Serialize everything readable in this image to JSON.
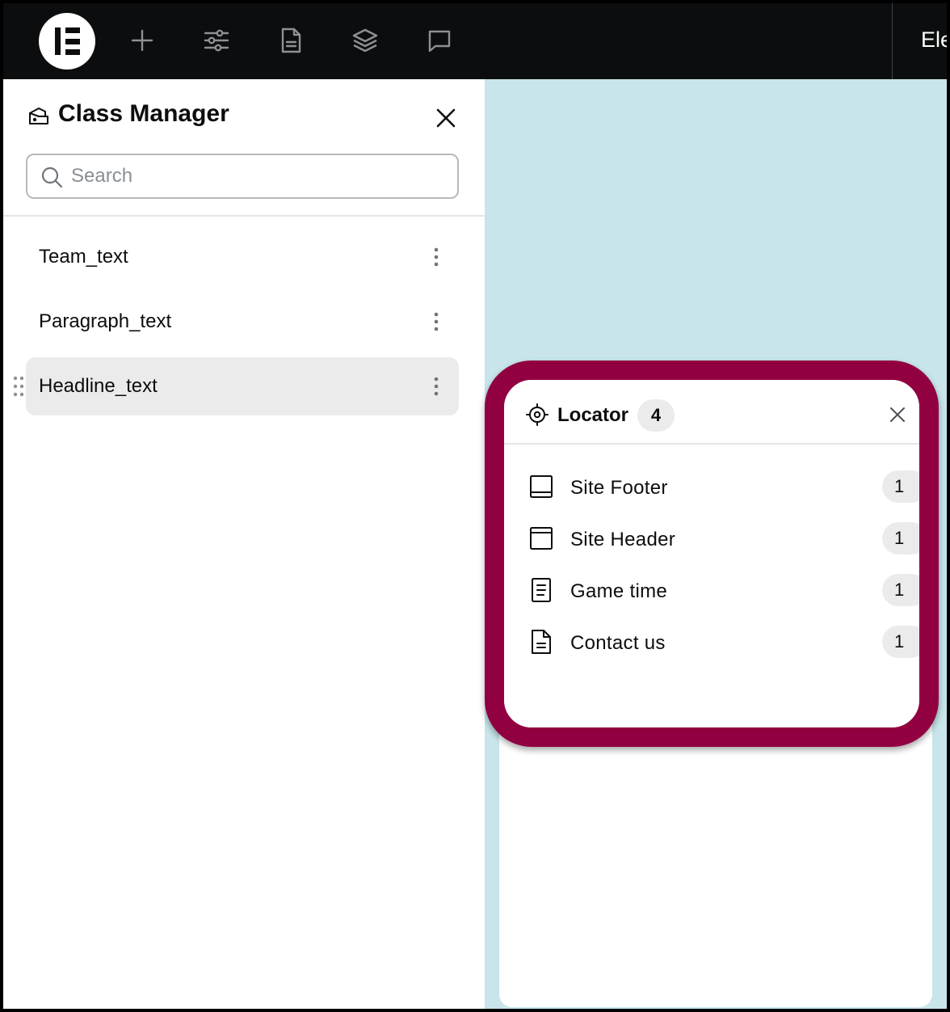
{
  "topbar": {
    "title": "Ele",
    "icons": [
      "elementor-logo-icon",
      "add-icon",
      "settings-sliders-icon",
      "page-icon",
      "layers-icon",
      "comment-icon"
    ]
  },
  "class_manager": {
    "title": "Class Manager",
    "search": {
      "placeholder": "Search",
      "value": ""
    },
    "classes": [
      {
        "label": "Team_text",
        "active": false
      },
      {
        "label": "Paragraph_text",
        "active": false
      },
      {
        "label": "Headline_text",
        "active": true
      }
    ]
  },
  "locator": {
    "title": "Locator",
    "count": "4",
    "items": [
      {
        "label": "Site Footer",
        "count": "1",
        "icon": "footer-icon"
      },
      {
        "label": "Site Header",
        "count": "1",
        "icon": "header-icon"
      },
      {
        "label": "Game time",
        "count": "1",
        "icon": "post-icon"
      },
      {
        "label": "Contact us",
        "count": "1",
        "icon": "page-icon"
      }
    ]
  },
  "colors": {
    "topbar_bg": "#0c0d0e",
    "canvas_bg": "#c7e5ea",
    "highlight": "#910040",
    "active_item_bg": "#ebebeb"
  }
}
